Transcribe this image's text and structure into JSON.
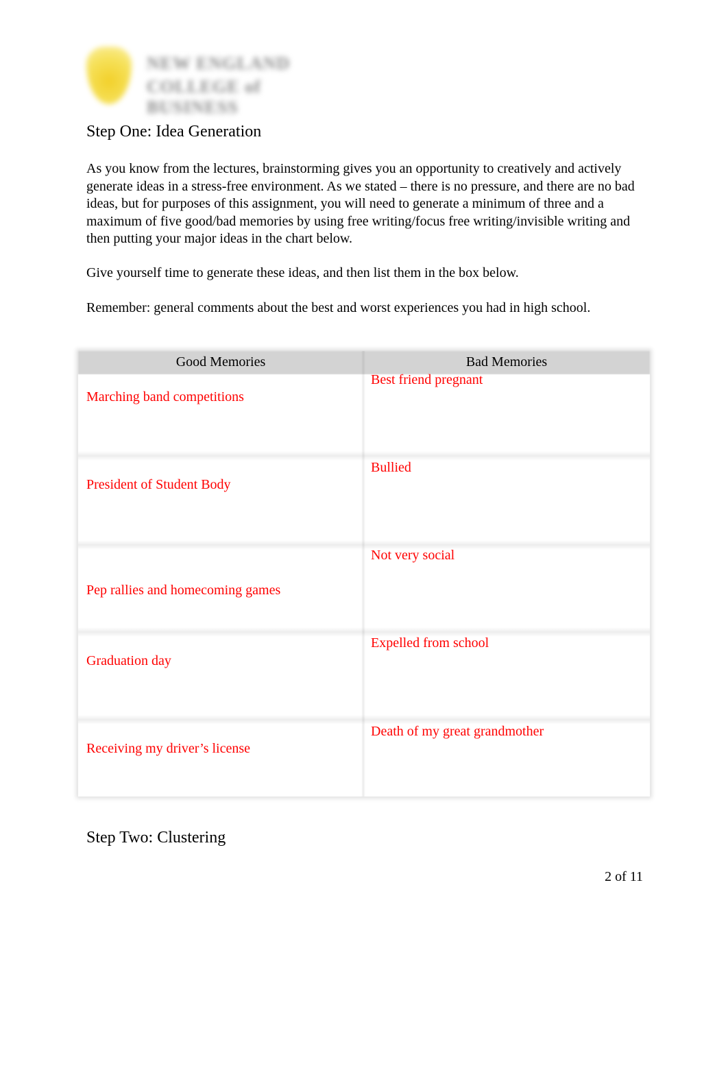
{
  "logo": {
    "icon": "shield-icon",
    "line1": "NEW ENGLAND",
    "line2": "COLLEGE of BUSINESS",
    "accent_color": "#f2d02a"
  },
  "step_one": {
    "heading": "Step One: Idea Generation",
    "paragraphs": [
      "As you know from the lectures, brainstorming  gives you an opportunity to creatively and actively generate ideas in a stress-free environment.    As we stated – there is no pressure, and there are no bad ideas, but for purposes of this assignment, you will need to generate a minimum of three and a maximum of five good/bad memories by using free writing/focus free writing/invisible writing and then putting your major ideas in the chart below.",
      "Give yourself time to generate these ideas, and then list them in the box below.",
      "Remember: general comments about the best and worst experiences you had in high school."
    ]
  },
  "memories_table": {
    "headers": [
      "Good Memories",
      "Bad Memories"
    ],
    "answer_color": "#ff0000",
    "rows": [
      {
        "good": "Marching band competitions",
        "bad": "Best friend pregnant"
      },
      {
        "good": "President of Student Body",
        "bad": "Bullied"
      },
      {
        "good": "Pep rallies and homecoming games",
        "bad": "Not very social"
      },
      {
        "good": "Graduation day",
        "bad": "Expelled from school"
      },
      {
        "good": "Receiving my driver’s license",
        "bad": "Death of my great grandmother"
      }
    ]
  },
  "step_two": {
    "heading": "Step Two: Clustering"
  },
  "footer": {
    "page_number": "2 of 11"
  }
}
